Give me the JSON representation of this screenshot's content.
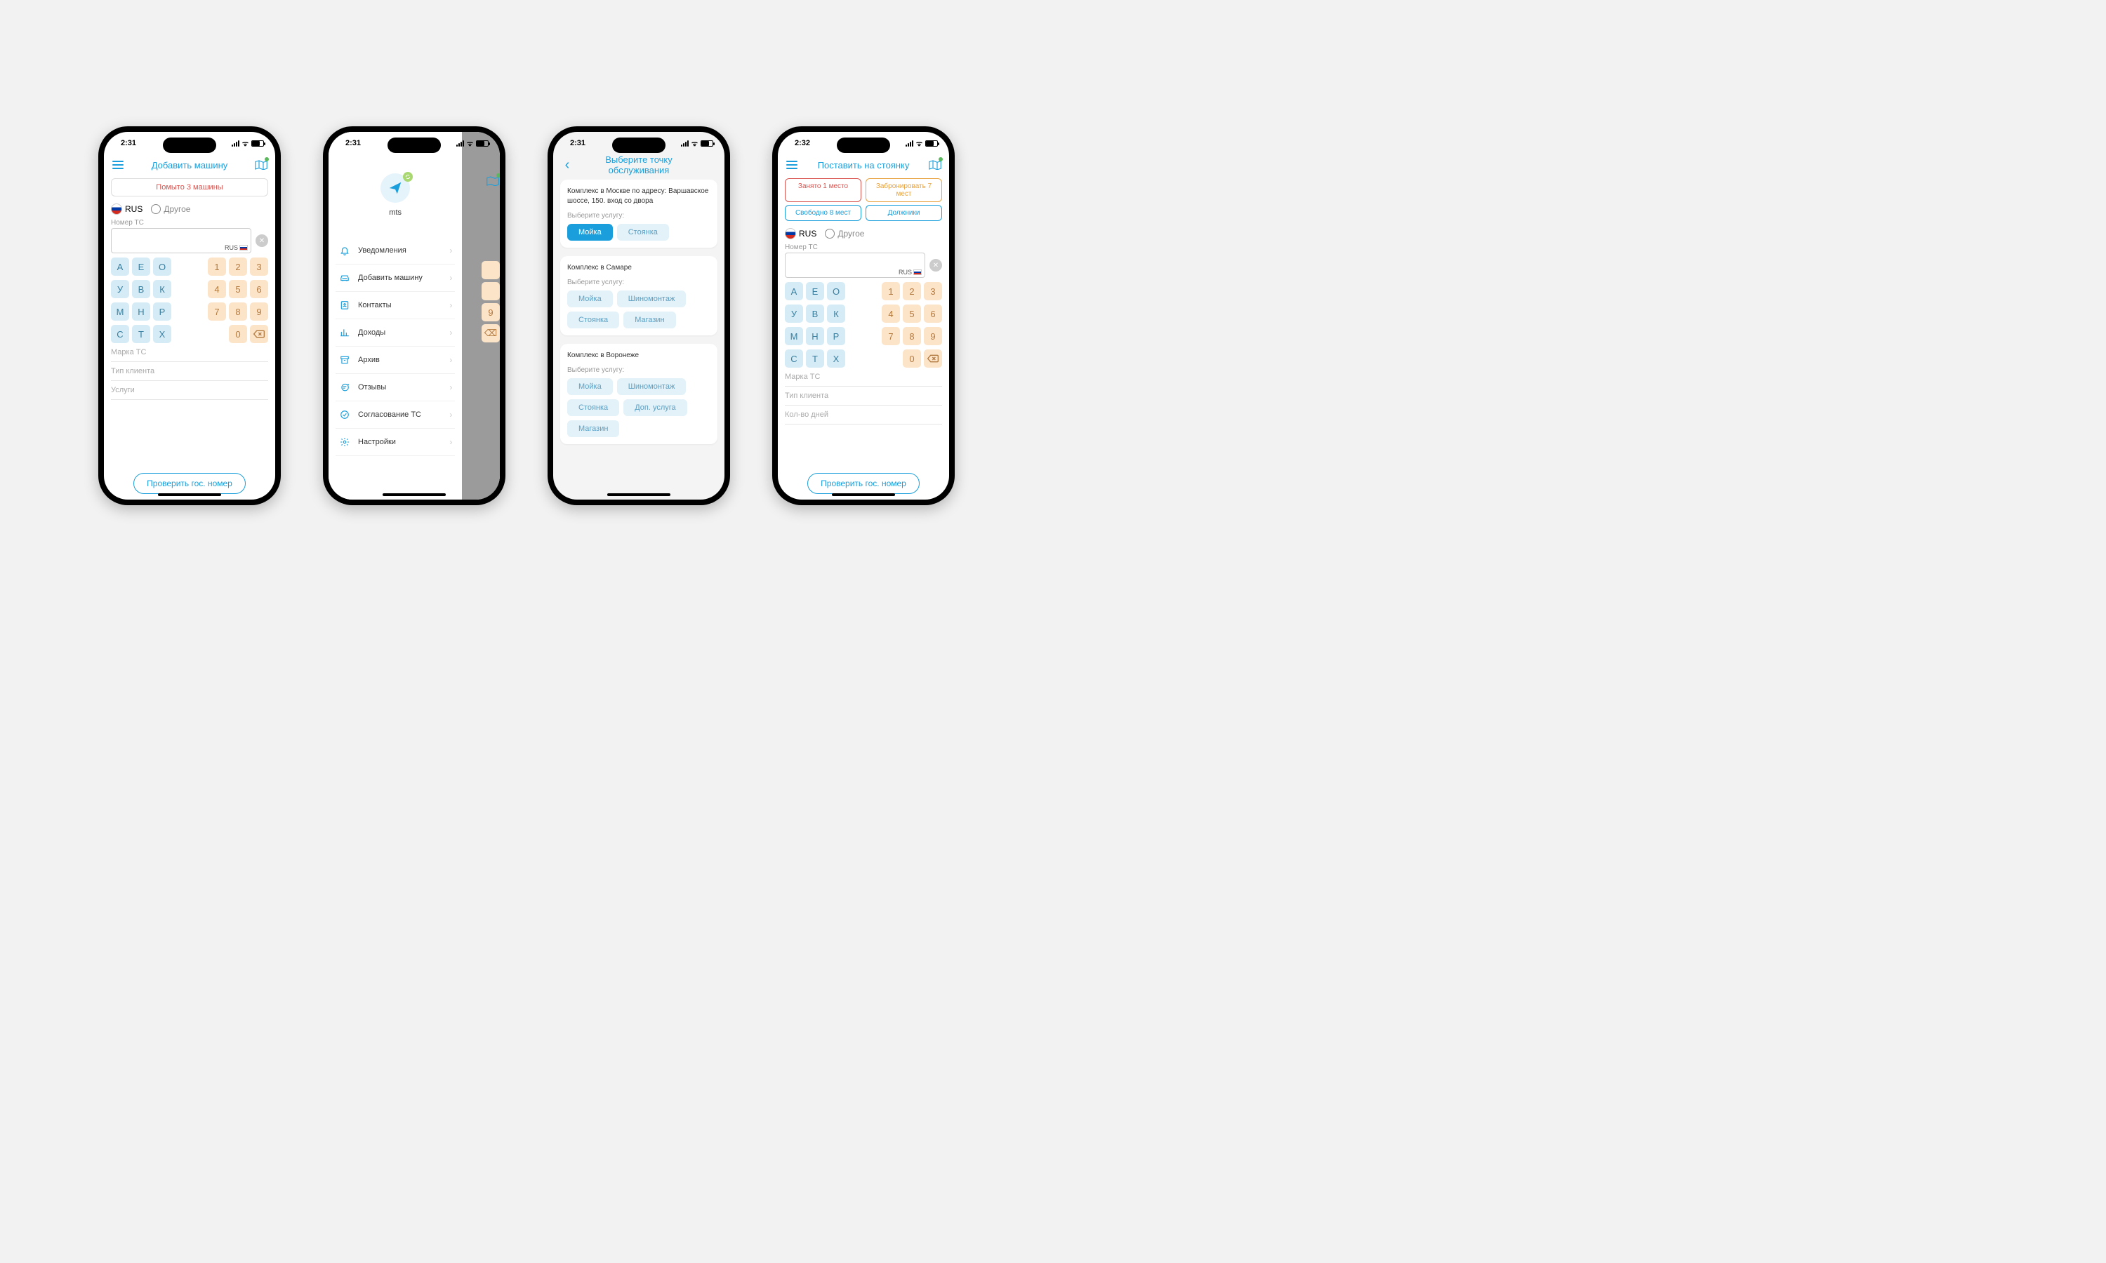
{
  "times": {
    "p1": "2:31",
    "p2": "2:31",
    "p3": "2:31",
    "p4": "2:32"
  },
  "p1": {
    "title": "Добавить машину",
    "banner": "Помыто 3 машины",
    "rus": "RUS",
    "other": "Другое",
    "label_plate": "Номер ТС",
    "plate_suffix": "RUS",
    "letters": [
      [
        "А",
        "Е",
        "О"
      ],
      [
        "У",
        "В",
        "К"
      ],
      [
        "М",
        "Н",
        "Р"
      ],
      [
        "С",
        "Т",
        "Х"
      ]
    ],
    "nums": [
      [
        "1",
        "2",
        "3"
      ],
      [
        "4",
        "5",
        "6"
      ],
      [
        "7",
        "8",
        "9"
      ],
      [
        "",
        "0",
        "⌫"
      ]
    ],
    "f_brand": "Марка ТС",
    "f_client": "Тип клиента",
    "f_services": "Услуги",
    "cta": "Проверить гос. номер"
  },
  "p2": {
    "username": "mts",
    "menu": [
      {
        "icon": "bell",
        "label": "Уведомления"
      },
      {
        "icon": "car",
        "label": "Добавить машину"
      },
      {
        "icon": "contacts",
        "label": "Контакты"
      },
      {
        "icon": "chart",
        "label": "Доходы"
      },
      {
        "icon": "archive",
        "label": "Архив"
      },
      {
        "icon": "reviews",
        "label": "Отзывы"
      },
      {
        "icon": "approve",
        "label": "Согласование ТС"
      },
      {
        "icon": "gear",
        "label": "Настройки"
      }
    ]
  },
  "p3": {
    "title": "Выберите точку обслуживания",
    "cards": [
      {
        "title": "Комплекс в Москве по адресу: Варшавское шоссе, 150. вход со двора",
        "sub": "Выберите услугу:",
        "buttons": [
          {
            "t": "Мойка",
            "primary": true
          },
          {
            "t": "Стоянка"
          }
        ]
      },
      {
        "title": "Комплекс в Самаре",
        "sub": "Выберите услугу:",
        "buttons": [
          {
            "t": "Мойка"
          },
          {
            "t": "Шиномонтаж"
          },
          {
            "t": "Стоянка"
          },
          {
            "t": "Магазин"
          }
        ]
      },
      {
        "title": "Комплекс в Воронеже",
        "sub": "Выберите услугу:",
        "buttons": [
          {
            "t": "Мойка"
          },
          {
            "t": "Шиномонтаж"
          },
          {
            "t": "Стоянка"
          },
          {
            "t": "Доп. услуга"
          },
          {
            "t": "Магазин"
          }
        ]
      }
    ]
  },
  "p4": {
    "title": "Поставить на стоянку",
    "chips": [
      {
        "t": "Занято 1 место",
        "c": "red"
      },
      {
        "t": "Забронировать 7 мест",
        "c": "orange"
      },
      {
        "t": "Свободно 8 мест",
        "c": "blue"
      },
      {
        "t": "Должники",
        "c": "blue"
      }
    ],
    "f_days": "Кол-во дней"
  }
}
